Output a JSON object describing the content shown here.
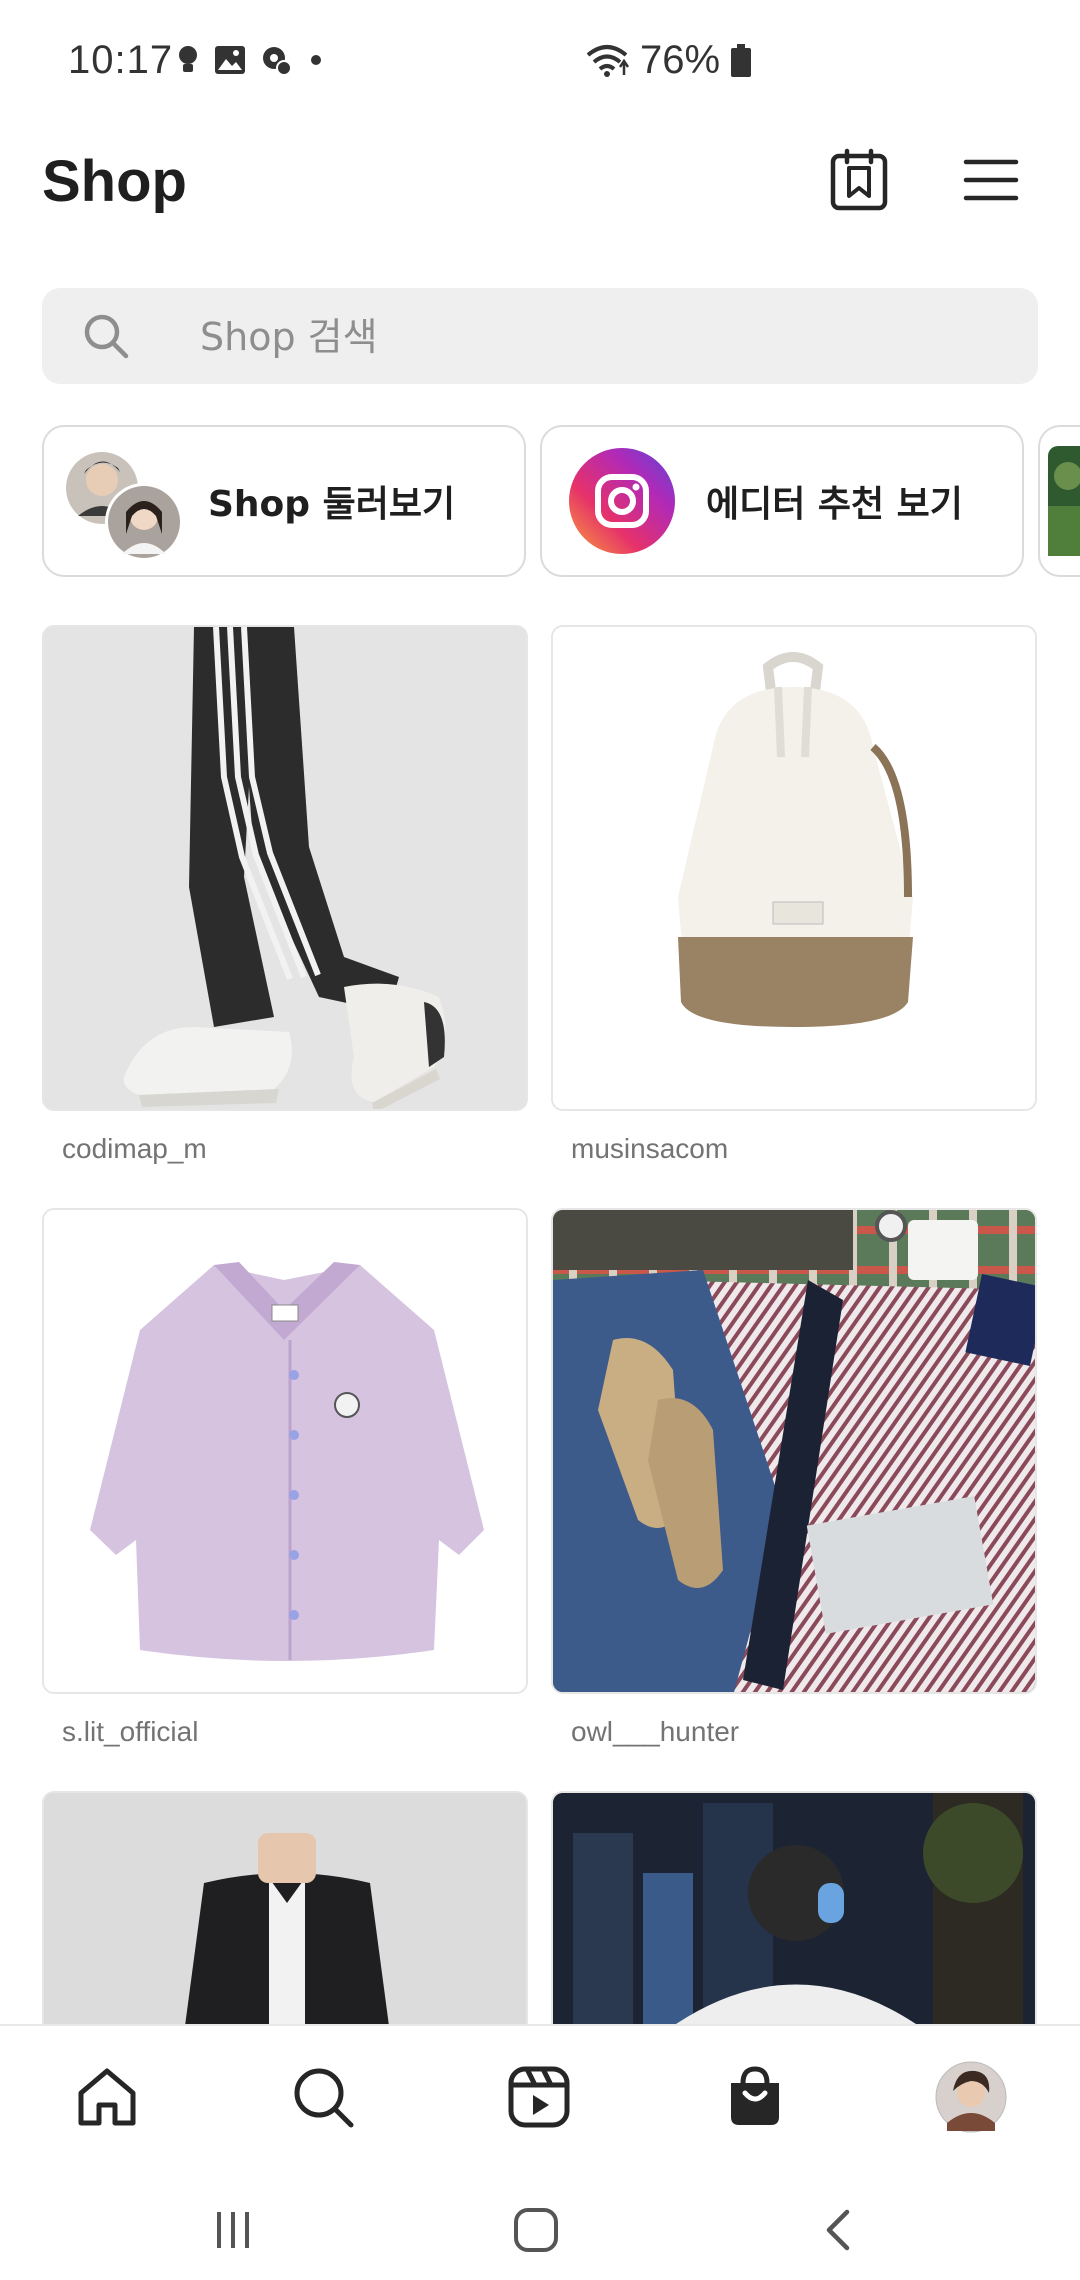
{
  "status_bar": {
    "time": "10:17",
    "battery": "76%"
  },
  "header": {
    "title": "Shop"
  },
  "search": {
    "placeholder": "Shop 검색"
  },
  "chips": [
    {
      "label": "Shop 둘러보기"
    },
    {
      "label": "에디터 추천 보기"
    }
  ],
  "grid": [
    {
      "username": "codimap_m"
    },
    {
      "username": "musinsacom"
    },
    {
      "username": "s.lit_official"
    },
    {
      "username": "owl___hunter"
    }
  ],
  "colors": {
    "accent": "#262626",
    "muted": "#737373",
    "search_bg": "#efefef"
  },
  "icons": {
    "header": [
      "wishlist-icon",
      "menu-icon"
    ],
    "bottom_nav": [
      "home-icon",
      "search-icon",
      "reels-icon",
      "shop-bag-icon",
      "profile-avatar"
    ],
    "system_nav": [
      "recents-icon",
      "home-button-icon",
      "back-icon"
    ]
  }
}
